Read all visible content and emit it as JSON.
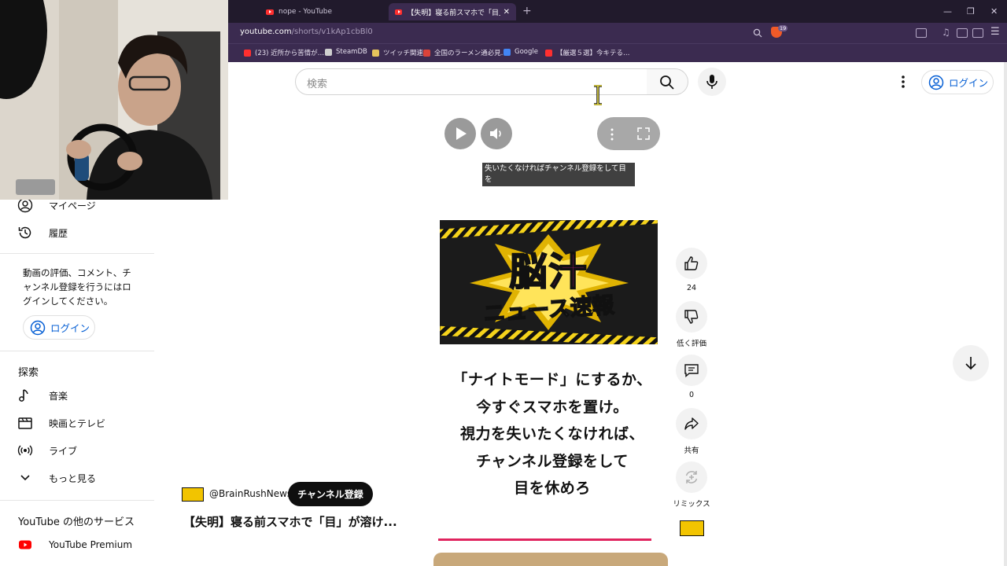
{
  "browser": {
    "tabs": [
      {
        "title": "nope - YouTube",
        "active": false
      },
      {
        "title": "【失明】寝る前スマホで「目」が溶け…",
        "active": true
      }
    ],
    "new_tab": "+",
    "window_controls": {
      "minimize": "—",
      "maximize": "❐",
      "close": "✕"
    },
    "url_host": "youtube.com",
    "url_path": "/shorts/v1kAp1cbBl0",
    "shield_badge": "19",
    "bookmarks": [
      {
        "label": "(23) 近所から苦情が…",
        "color": "#ff2f2f"
      },
      {
        "label": "SteamDB",
        "color": "#cfcfcf"
      },
      {
        "label": "ツイッチ関連",
        "color": "#e6c35c"
      },
      {
        "label": "全国のラーメン通必見…",
        "color": "#d9433a"
      },
      {
        "label": "Google",
        "color": "#4285f4"
      },
      {
        "label": "【厳選５選】今キテる…",
        "color": "#ff2f2f"
      }
    ]
  },
  "header": {
    "search_placeholder": "検索",
    "login_label": "ログイン"
  },
  "sidebar": {
    "my_page": "マイページ",
    "history": "履歴",
    "login_prompt": "動画の評価、コメント、チャンネル登録を行うにはログインしてください。",
    "login_label": "ログイン",
    "explore_heading": "探索",
    "explore_items": [
      {
        "label": "音楽",
        "icon": "music-note-icon"
      },
      {
        "label": "映画とテレビ",
        "icon": "clapperboard-icon"
      },
      {
        "label": "ライブ",
        "icon": "live-broadcast-icon"
      },
      {
        "label": "もっと見る",
        "icon": "chevron-down-icon"
      }
    ],
    "more_services_heading": "YouTube の他のサービス",
    "premium_label": "YouTube Premium"
  },
  "player": {
    "caption": "失いたくなければチャンネル登録をして目を",
    "banner_line1": "脳汁",
    "banner_line2": "ニュース速報",
    "overlay_lines": [
      "「ナイトモード」にするか、",
      "今すぐスマホを置け。",
      "視力を失いたくなければ、",
      "チャンネル登録をして",
      "目を休めろ"
    ],
    "progress_fraction": 0.98
  },
  "actions": {
    "like_count": "24",
    "dislike_label": "低く評価",
    "comment_count": "0",
    "share_label": "共有",
    "remix_label": "リミックス"
  },
  "channel": {
    "handle": "@BrainRushNews",
    "subscribe_label": "チャンネル登録",
    "video_title": "【失明】寝る前スマホで「目」が溶け..."
  },
  "colors": {
    "accent_blue": "#065fd4",
    "yt_red": "#ff0000",
    "browser_bg": "#211a2c",
    "progress": "#e0245e"
  }
}
